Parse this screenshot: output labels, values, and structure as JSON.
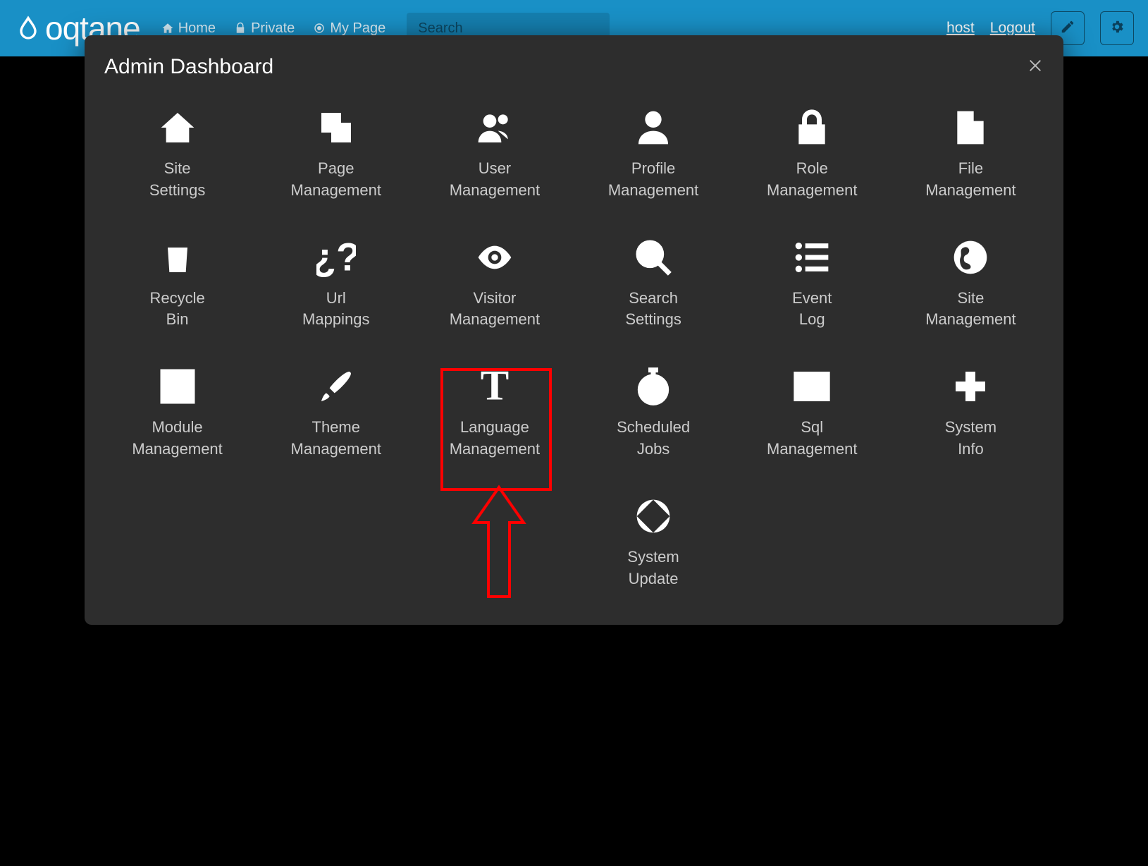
{
  "topbar": {
    "logo_text": "oqtane",
    "nav": {
      "home": "Home",
      "private": "Private",
      "mypage": "My Page"
    },
    "search_placeholder": "Search",
    "user_label": "host",
    "logout_label": "Logout"
  },
  "modal": {
    "title": "Admin Dashboard"
  },
  "tiles": {
    "site_settings": "Site\nSettings",
    "page_management": "Page\nManagement",
    "user_management": "User\nManagement",
    "profile_management": "Profile\nManagement",
    "role_management": "Role\nManagement",
    "file_management": "File\nManagement",
    "recycle_bin": "Recycle\nBin",
    "url_mappings": "Url\nMappings",
    "visitor_management": "Visitor\nManagement",
    "search_settings": "Search\nSettings",
    "event_log": "Event\nLog",
    "site_management": "Site\nManagement",
    "module_management": "Module\nManagement",
    "theme_management": "Theme\nManagement",
    "language_management": "Language\nManagement",
    "scheduled_jobs": "Scheduled\nJobs",
    "sql_management": "Sql\nManagement",
    "system_info": "System\nInfo",
    "system_update": "System\nUpdate"
  },
  "annotation": {
    "highlighted_tile": "scheduled_jobs",
    "highlight_color": "#ff0000"
  }
}
